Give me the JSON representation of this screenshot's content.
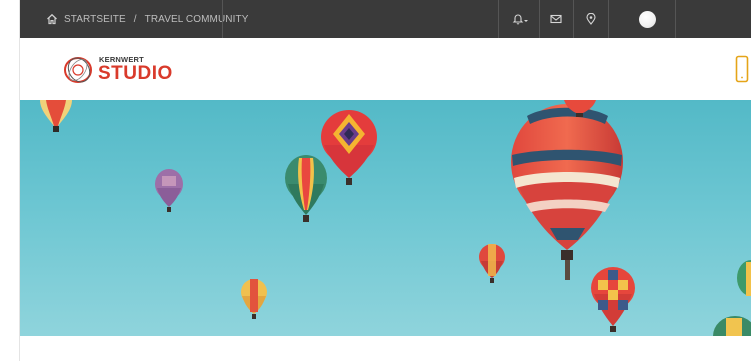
{
  "breadcrumb": {
    "home_label": "STARTSEITE",
    "separator": "/",
    "current_label": "TRAVEL COMMUNITY"
  },
  "topbar": {
    "icons": [
      "bell-icon",
      "chevron-down-icon",
      "mail-icon",
      "location-pin-icon",
      "avatar"
    ]
  },
  "logo": {
    "line1": "KERNWERT",
    "line2": "STUDIO"
  },
  "header": {
    "phone_icon": "mobile-phone-icon",
    "accent_color": "#e5a418"
  },
  "hero": {
    "image_alt": "hot-air balloons in blue sky",
    "sky_color": "#5cbdc9"
  },
  "colors": {
    "topbar": "#3a3a3a",
    "brand_red": "#d93a2b"
  }
}
